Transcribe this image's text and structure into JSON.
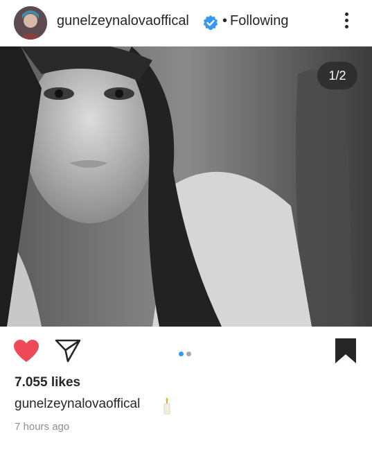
{
  "post": {
    "author": {
      "username": "gunelzeynalovaoffical",
      "verified": true
    },
    "separator": "•",
    "follow_status": "Following",
    "more_icon": "more-vertical-icon",
    "media": {
      "index_label": "1/2",
      "slide_count": 2,
      "active_slide": 1
    },
    "actions": {
      "like_icon": "heart-filled-icon",
      "share_icon": "paper-plane-icon",
      "save_icon": "bookmark-filled-icon"
    },
    "likes_label": "7.055 likes",
    "caption": {
      "username": "gunelzeynalovaoffical",
      "emoji_icon": "candle-icon"
    },
    "timestamp": "7 hours ago"
  },
  "colors": {
    "like_red": "#ed4956",
    "verified_blue": "#3897f0",
    "active_dot": "#3897f0",
    "inactive_dot": "#a8a8a8",
    "text": "#262626",
    "muted": "#8e8e8e"
  }
}
